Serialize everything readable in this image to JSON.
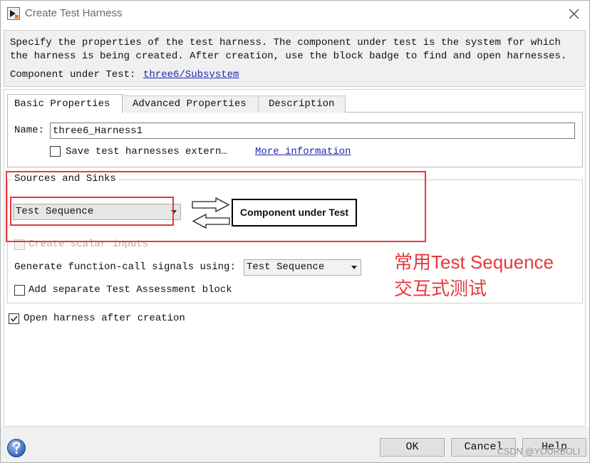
{
  "window": {
    "title": "Create Test Harness",
    "app_icon": "simulink-icon",
    "close_icon": "close-icon"
  },
  "description": {
    "line1": "Specify the properties of the test harness. The component under test is the system for which",
    "line2": "the harness is being created. After creation, use the block badge to find and open harnesses.",
    "component_label": "Component under Test:",
    "component_link": "three6/Subsystem"
  },
  "tabs": [
    {
      "label": "Basic Properties",
      "selected": true
    },
    {
      "label": "Advanced Properties",
      "selected": false
    },
    {
      "label": "Description",
      "selected": false
    }
  ],
  "basic": {
    "name_label": "Name:",
    "name_value": "three6_Harness1",
    "save_external_label": "Save test harnesses extern…",
    "save_external_checked": false,
    "more_info_link": "More information"
  },
  "sources_sinks": {
    "group_title": "Sources and Sinks",
    "source_sink_select": "Test Sequence",
    "diagram_box_label": "Component under Test",
    "create_scalar_label": "Create scalar inputs",
    "create_scalar_checked": false,
    "create_scalar_disabled": true,
    "function_call_label": "Generate function-call signals using:",
    "function_call_select": "Test Sequence",
    "assessment_label": "Add separate Test Assessment block",
    "assessment_checked": false
  },
  "open_after_creation": {
    "label": "Open harness after creation",
    "checked": true
  },
  "buttons": {
    "ok": "OK",
    "cancel": "Cancel",
    "help": "Help",
    "help_icon": "help-icon"
  },
  "annotation": {
    "line1": "常用Test Sequence",
    "line2": "交互式测试"
  },
  "watermark": "CSDN @YOURBOLI",
  "colors": {
    "annotation": "#e8383d",
    "link": "#2424b0",
    "disabled_text": "#adadad"
  }
}
